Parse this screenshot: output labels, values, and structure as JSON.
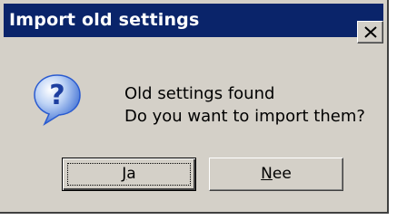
{
  "window": {
    "title": "Import old settings"
  },
  "message": {
    "line1": "Old settings found",
    "line2": "Do you want to import them?"
  },
  "buttons": {
    "yes": {
      "mnemonic": "J",
      "rest": "a"
    },
    "no": {
      "mnemonic": "N",
      "rest": "ee"
    }
  },
  "icons": {
    "dialog": "question-icon",
    "close": "close-icon"
  },
  "colors": {
    "titlebar": "#0a246a",
    "title_text": "#ffffff",
    "face": "#d4d0c8",
    "icon_blue": "#2a5bd0"
  }
}
